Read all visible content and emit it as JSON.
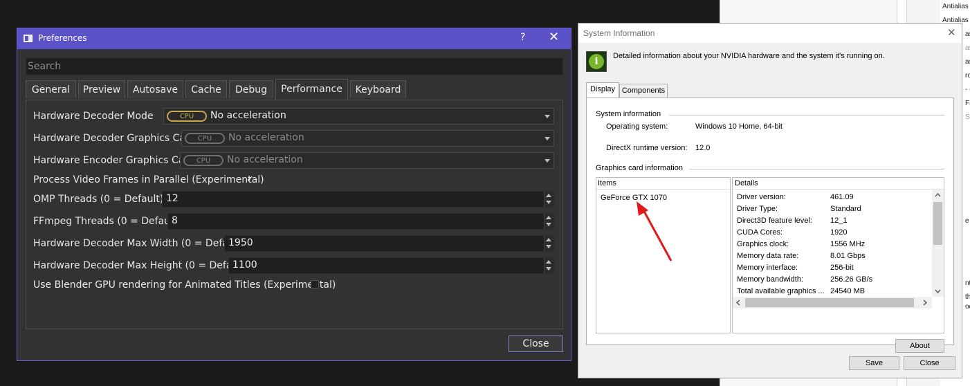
{
  "preferences": {
    "window_title": "Preferences",
    "help_glyph": "?",
    "close_glyph": "✕",
    "search_placeholder": "Search",
    "tabs": [
      "General",
      "Preview",
      "Autosave",
      "Cache",
      "Debug",
      "Performance",
      "Keyboard"
    ],
    "active_tab": "Performance",
    "rows": {
      "decoder_mode": {
        "label": "Hardware Decoder Mode",
        "badge": "CPU",
        "value": "No acceleration"
      },
      "decoder_card": {
        "label": "Hardware Decoder Graphics Card",
        "badge": "CPU",
        "value": "No acceleration"
      },
      "encoder_card": {
        "label": "Hardware Encoder Graphics Card",
        "badge": "CPU",
        "value": "No acceleration"
      },
      "parallel": {
        "label": "Process Video Frames in Parallel (Experimental)",
        "checked": true,
        "check_glyph": "✓"
      },
      "omp_threads": {
        "label": "OMP Threads (0 = Default)",
        "value": "12"
      },
      "ffmpeg_threads": {
        "label": "FFmpeg Threads (0 = Default)",
        "value": "8"
      },
      "max_width": {
        "label": "Hardware Decoder Max Width (0 = Default)",
        "value": "1950"
      },
      "max_height": {
        "label": "Hardware Decoder Max Height (0 = Default)",
        "value": "1100"
      },
      "blender_gpu": {
        "label": "Use Blender GPU rendering for Animated Titles (Experimental)",
        "checked": false
      }
    },
    "close_button": "Close",
    "colors": {
      "titlebar": "#5c52c8",
      "badge_active": "#c9a650",
      "body": "#323232"
    }
  },
  "system_info": {
    "window_title": "System Information",
    "close_glyph": "✕",
    "icon_glyph": "i",
    "description": "Detailed information about your NVIDIA hardware and the system it's running on.",
    "tabs": [
      "Display",
      "Components"
    ],
    "active_tab": "Display",
    "system_group": {
      "title": "System information",
      "os_label": "Operating system:",
      "os_value": "Windows 10 Home, 64-bit",
      "directx_label": "DirectX runtime version:",
      "directx_value": "12.0"
    },
    "graphics_group": {
      "title": "Graphics card information",
      "items_header": "Items",
      "details_header": "Details",
      "items": [
        "GeForce GTX 1070"
      ],
      "details": [
        {
          "k": "Driver version:",
          "v": "461.09"
        },
        {
          "k": "Driver Type:",
          "v": "Standard"
        },
        {
          "k": "Direct3D feature level:",
          "v": "12_1"
        },
        {
          "k": "CUDA Cores:",
          "v": "1920"
        },
        {
          "k": "Graphics clock:",
          "v": "1556 MHz"
        },
        {
          "k": "Memory data rate:",
          "v": "8.01 Gbps"
        },
        {
          "k": "Memory interface:",
          "v": "256-bit"
        },
        {
          "k": "Memory bandwidth:",
          "v": "256.26 GB/s"
        },
        {
          "k": "Total available graphics ...",
          "v": "24540 MB"
        }
      ]
    },
    "about_button": "About",
    "save_button": "Save",
    "close_button": "Close",
    "annotation_color": "#e0191b"
  },
  "background": {
    "snippets": [
      "Antialias",
      "Antialias",
      "as",
      "as",
      "as",
      "rou",
      "- (",
      "- (",
      "Fa",
      "Sm",
      "e s",
      "nte",
      "the",
      "oot"
    ]
  }
}
